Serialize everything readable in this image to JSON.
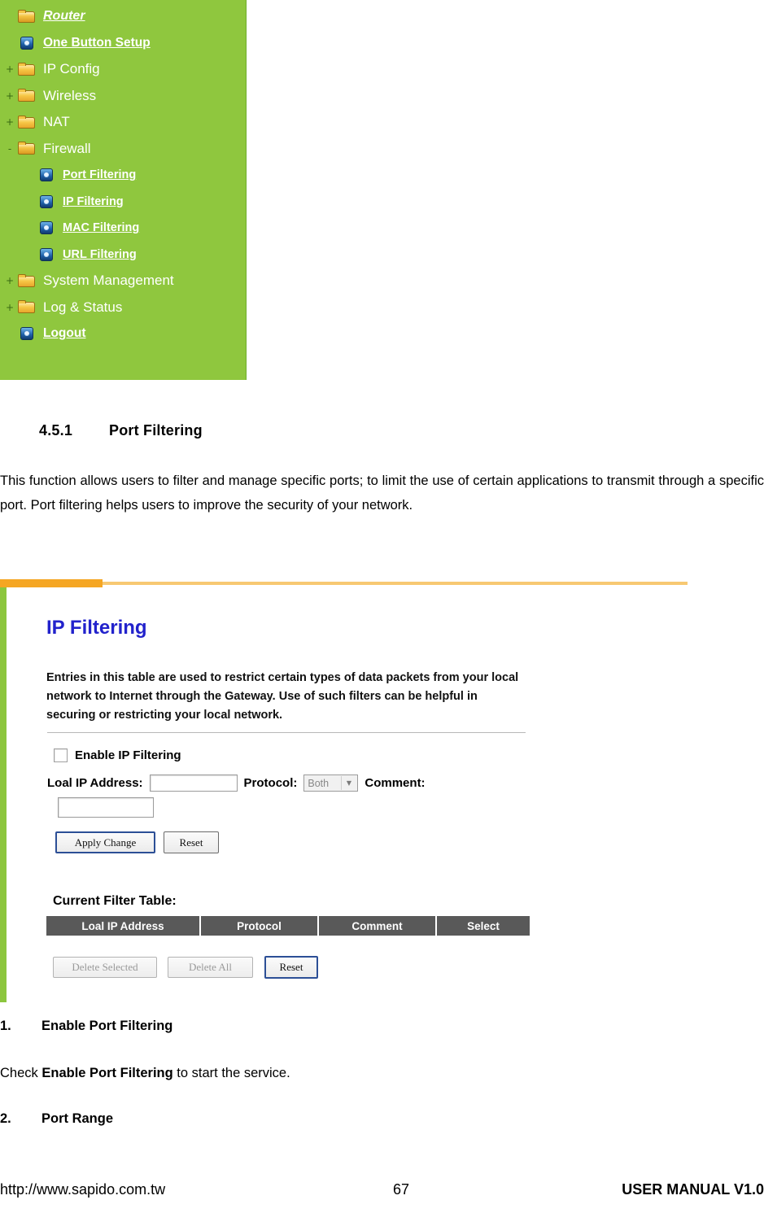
{
  "sidebar": {
    "items": [
      {
        "label": "Router",
        "icon": "folder-open-icon",
        "twisty": "",
        "indent": false,
        "link": true,
        "style": "top"
      },
      {
        "label": "One Button Setup",
        "icon": "bullet-icon",
        "twisty": "",
        "indent": false,
        "link": true,
        "style": "link"
      },
      {
        "label": "IP Config",
        "icon": "folder-icon",
        "twisty": "+",
        "indent": false,
        "link": false,
        "style": "plain"
      },
      {
        "label": "Wireless",
        "icon": "folder-icon",
        "twisty": "+",
        "indent": false,
        "link": false,
        "style": "plain"
      },
      {
        "label": "NAT",
        "icon": "folder-icon",
        "twisty": "+",
        "indent": false,
        "link": false,
        "style": "plain"
      },
      {
        "label": "Firewall",
        "icon": "folder-open-icon",
        "twisty": "-",
        "indent": false,
        "link": false,
        "style": "plain"
      },
      {
        "label": "Port Filtering",
        "icon": "bullet-icon",
        "twisty": "",
        "indent": true,
        "link": true,
        "style": "link"
      },
      {
        "label": "IP Filtering",
        "icon": "bullet-icon",
        "twisty": "",
        "indent": true,
        "link": true,
        "style": "link"
      },
      {
        "label": "MAC Filtering",
        "icon": "bullet-icon",
        "twisty": "",
        "indent": true,
        "link": true,
        "style": "link"
      },
      {
        "label": "URL Filtering",
        "icon": "bullet-icon",
        "twisty": "",
        "indent": true,
        "link": true,
        "style": "link"
      },
      {
        "label": "System Management",
        "icon": "folder-icon",
        "twisty": "+",
        "indent": false,
        "link": false,
        "style": "plain"
      },
      {
        "label": "Log & Status",
        "icon": "folder-icon",
        "twisty": "+",
        "indent": false,
        "link": false,
        "style": "plain"
      },
      {
        "label": "Logout",
        "icon": "bullet-icon",
        "twisty": "",
        "indent": false,
        "link": true,
        "style": "link"
      }
    ]
  },
  "section": {
    "number": "4.5.1",
    "title": "Port Filtering",
    "paragraph": "This function allows users to filter and manage specific ports; to limit the use of certain applications to transmit through a specific port. Port filtering helps users to improve the security of your network."
  },
  "panel": {
    "title": "IP Filtering",
    "description": "Entries in this table are used to restrict certain types of data packets from your local network to Internet through the Gateway. Use of such filters can be helpful in securing or restricting your local network.",
    "enable_checkbox_label": "Enable IP Filtering",
    "local_ip_label": "Loal IP Address:",
    "local_ip_value": "",
    "protocol_label": "Protocol:",
    "protocol_value": "Both",
    "comment_label": "Comment:",
    "comment_value": "",
    "apply_button": "Apply Change",
    "reset_button": "Reset",
    "current_filter_table_label": "Current Filter Table:",
    "table_headers": [
      "Loal IP Address",
      "Protocol",
      "Comment",
      "Select"
    ],
    "delete_selected_button": "Delete Selected",
    "delete_all_button": "Delete All",
    "reset_button2": "Reset"
  },
  "items": {
    "one_number": "1.",
    "one_title": "Enable Port Filtering",
    "check_text_prefix": "Check ",
    "check_text_bold": "Enable Port Filtering",
    "check_text_suffix": " to start the service.",
    "two_number": "2.",
    "two_title": "Port Range"
  },
  "footer": {
    "url": "http://www.sapido.com.tw",
    "page": "67",
    "manual": "USER MANUAL V1.0"
  }
}
